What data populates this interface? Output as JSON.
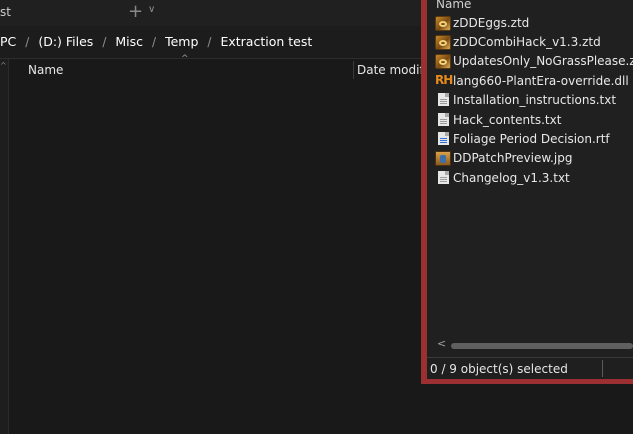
{
  "window": {
    "tab_fragment": "st",
    "new_tab_glyph": "+",
    "tab_chevron": "∨"
  },
  "breadcrumb": [
    "PC",
    "(D:) Files",
    "Misc",
    "Temp",
    "Extraction test"
  ],
  "breadcrumb_separator": "/",
  "columns": {
    "name": "Name",
    "date_modified": "Date modified"
  },
  "popup": {
    "header": "Name",
    "files": [
      {
        "name": "zDDEggs.ztd",
        "icon": "ztd-archive-icon"
      },
      {
        "name": "zDDCombiHack_v1.3.ztd",
        "icon": "ztd-archive-icon"
      },
      {
        "name": "UpdatesOnly_NoGrassPlease.ztd",
        "icon": "ztd-archive-icon"
      },
      {
        "name": "lang660-PlantEra-override.dll",
        "icon": "rh-dll-icon",
        "icon_text": "RH"
      },
      {
        "name": "Installation_instructions.txt",
        "icon": "text-document-icon"
      },
      {
        "name": "Hack_contents.txt",
        "icon": "text-document-icon"
      },
      {
        "name": "Foliage Period Decision.rtf",
        "icon": "rtf-document-icon"
      },
      {
        "name": "DDPatchPreview.jpg",
        "icon": "jpg-image-icon"
      },
      {
        "name": "Changelog_v1.3.txt",
        "icon": "text-document-icon"
      }
    ],
    "status": "0 / 9 object(s) selected"
  },
  "colors": {
    "background": "#191919",
    "popup_border": "#9b2f32",
    "popup_background": "#202020"
  }
}
